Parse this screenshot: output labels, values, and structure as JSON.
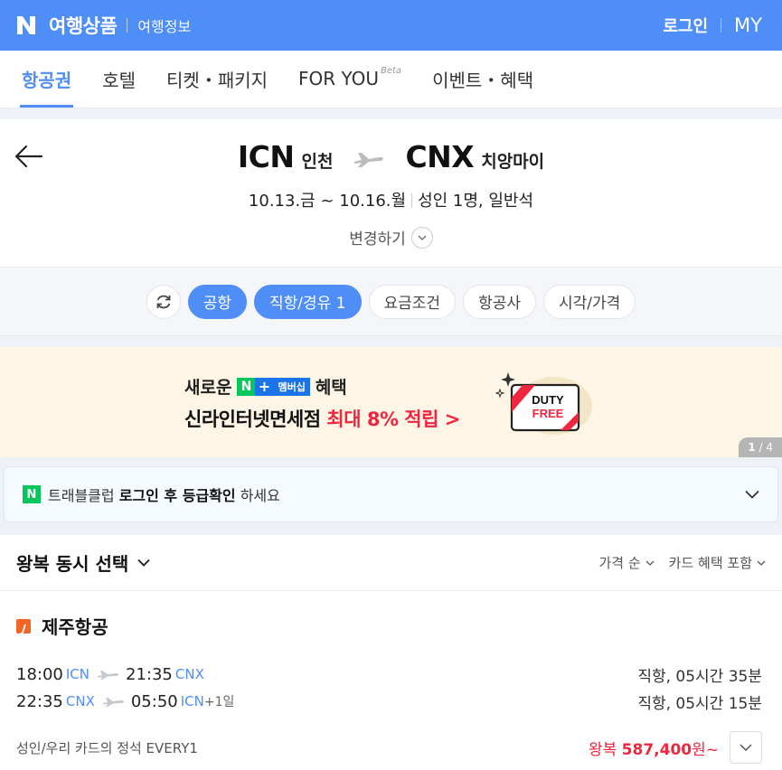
{
  "header": {
    "brand": "여행상품",
    "sub": "여행정보",
    "login": "로그인",
    "my": "MY"
  },
  "categories": [
    {
      "label": "항공권",
      "active": true
    },
    {
      "label": "호텔"
    },
    {
      "label": "티켓・패키지"
    },
    {
      "label": "FOR YOU",
      "badge": "Beta"
    },
    {
      "label": "이벤트・혜택"
    }
  ],
  "route": {
    "from_code": "ICN",
    "from_city": "인천",
    "to_code": "CNX",
    "to_city": "치앙마이",
    "dates": "10.13.금 ~ 10.16.월",
    "passengers": "성인 1명, 일반석",
    "change_label": "변경하기"
  },
  "filters": {
    "airport": "공항",
    "direct": "직항/경유 1",
    "fare": "요금조건",
    "airline": "항공사",
    "time_price": "시각/가격"
  },
  "banner": {
    "line1_pre": "새로운",
    "badge_n": "N",
    "badge_plus": "+",
    "badge_member": "멤버십",
    "line1_post": "혜택",
    "line2_pre": "신라인터넷면세점",
    "line2_red": "최대 8% 적립 >",
    "duty_line1": "DUTY",
    "duty_line2": "FREE",
    "pager_current": "1",
    "pager_total": "/ 4"
  },
  "notice": {
    "badge": "N",
    "pre": "트래블클럽",
    "bold": "로그인 후 등급확인",
    "post": "하세요"
  },
  "sort": {
    "title": "왕복 동시 선택",
    "price_order": "가격 순",
    "card_benefit": "카드 혜택 포함"
  },
  "flight": {
    "airline": "제주항공",
    "out": {
      "dep_time": "18:00",
      "dep_ap": "ICN",
      "arr_time": "21:35",
      "arr_ap": "CNX",
      "duration": "직항, 05시간 35분"
    },
    "ret": {
      "dep_time": "22:35",
      "dep_ap": "CNX",
      "arr_time": "05:50",
      "arr_ap": "ICN",
      "plus_day": "+1일",
      "duration": "직항, 05시간 15분"
    },
    "card_label": "성인/우리 카드의 정석 EVERY1",
    "price_prefix": "왕복",
    "price": "587,400",
    "price_suffix": "원~"
  },
  "colors": {
    "brand_blue": "#4e8ef6",
    "price_red": "#f0263f",
    "naver_green": "#03c75a",
    "jeju_orange": "#f26522"
  }
}
